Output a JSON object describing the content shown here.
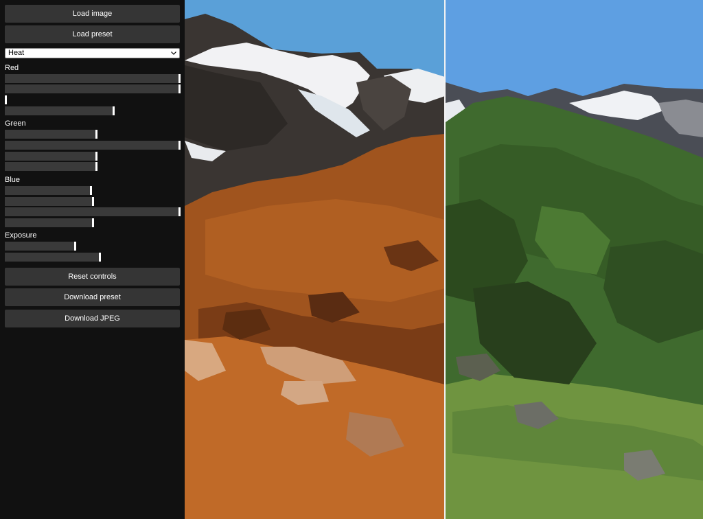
{
  "buttons": {
    "load_image": "Load image",
    "load_preset": "Load preset",
    "reset_controls": "Reset controls",
    "download_preset": "Download preset",
    "download_jpeg": "Download JPEG"
  },
  "preset_select": {
    "selected": "Heat",
    "icon": "chevron-down-icon"
  },
  "groups": [
    {
      "label": "Red",
      "sliders": [
        1.0,
        1.0,
        0.0,
        0.62
      ]
    },
    {
      "label": "Green",
      "sliders": [
        0.52,
        1.0,
        0.52,
        0.52
      ]
    },
    {
      "label": "Blue",
      "sliders": [
        0.49,
        0.5,
        1.0,
        0.5
      ]
    },
    {
      "label": "Exposure",
      "sliders": [
        0.4,
        0.54
      ]
    }
  ],
  "image": {
    "subject": "alpine mountain landscape",
    "split": "before-after comparison",
    "colors": {
      "sky": "#5aa0d8",
      "snow": "#f2f2f4",
      "rock_dark": "#3a3532",
      "filtered_slope": "#a0541e",
      "filtered_slope_light": "#c06a28",
      "original_slope": "#3f6a2e",
      "original_slope_light": "#6f9440",
      "divider": "#f2f2f2"
    }
  }
}
